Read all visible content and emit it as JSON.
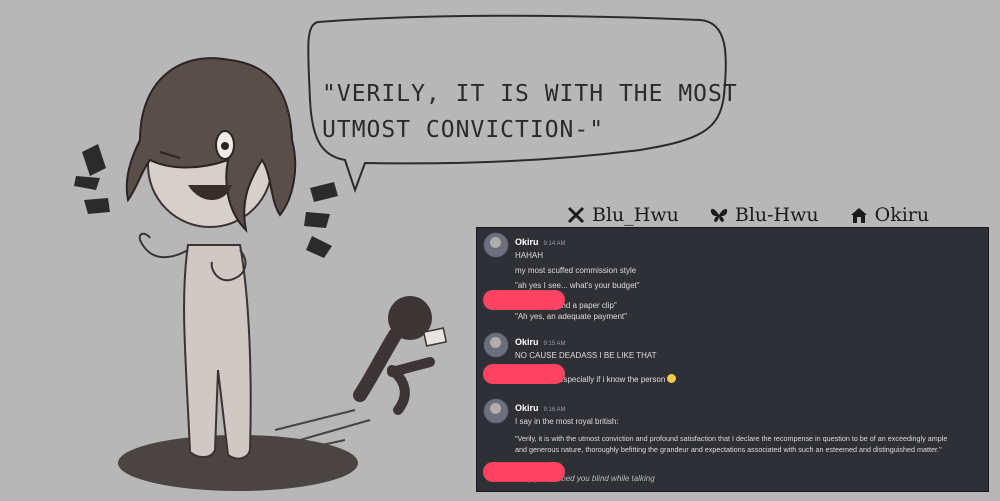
{
  "speech_bubble": {
    "line1": "\"VERILY, IT IS WITH THE MOST",
    "line2": "UTMOST CONVICTION-\""
  },
  "socials": [
    {
      "icon": "x-icon",
      "handle": "Blu_Hwu"
    },
    {
      "icon": "butterfly-icon",
      "handle": "Blu-Hwu"
    },
    {
      "icon": "home-icon",
      "handle": "Okiru"
    }
  ],
  "chat": {
    "messages": [
      {
        "author": "Okiru",
        "time": "9:14 AM",
        "lines": [
          "HAHAH",
          "my most scuffed commission style",
          "\"ah yes I see... what's your budget\""
        ]
      },
      {
        "author": "",
        "lines": [
          "\"One apple and a paper clip\"",
          "\"Ah yes, an adequate payment\""
        ]
      },
      {
        "author": "Okiru",
        "time": "9:15 AM",
        "lines": [
          "NO CAUSE DEADASS I BE LIKE THAT"
        ]
      },
      {
        "author": "",
        "lines": [
          "yea me too, especially if  i  know the person"
        ]
      },
      {
        "author": "Okiru",
        "time": "9:16 AM",
        "lines": [
          "I say in the most royal british:",
          "\"Verily, it is with the utmost conviction and profound satisfaction that I declare the recompense in question to be of an exceedingly ample",
          "and generous nature, thoroughly befitting the grandeur and expectations associated with such an esteemed and distinguished matter.\""
        ]
      },
      {
        "author": "",
        "lines": [
          "They just robbed you blind while talking"
        ]
      }
    ]
  },
  "colors": {
    "background": "#b7b7b7",
    "chat_bg": "#2f3036",
    "redaction": "#ff4463",
    "ink": "#2b2b2b"
  }
}
